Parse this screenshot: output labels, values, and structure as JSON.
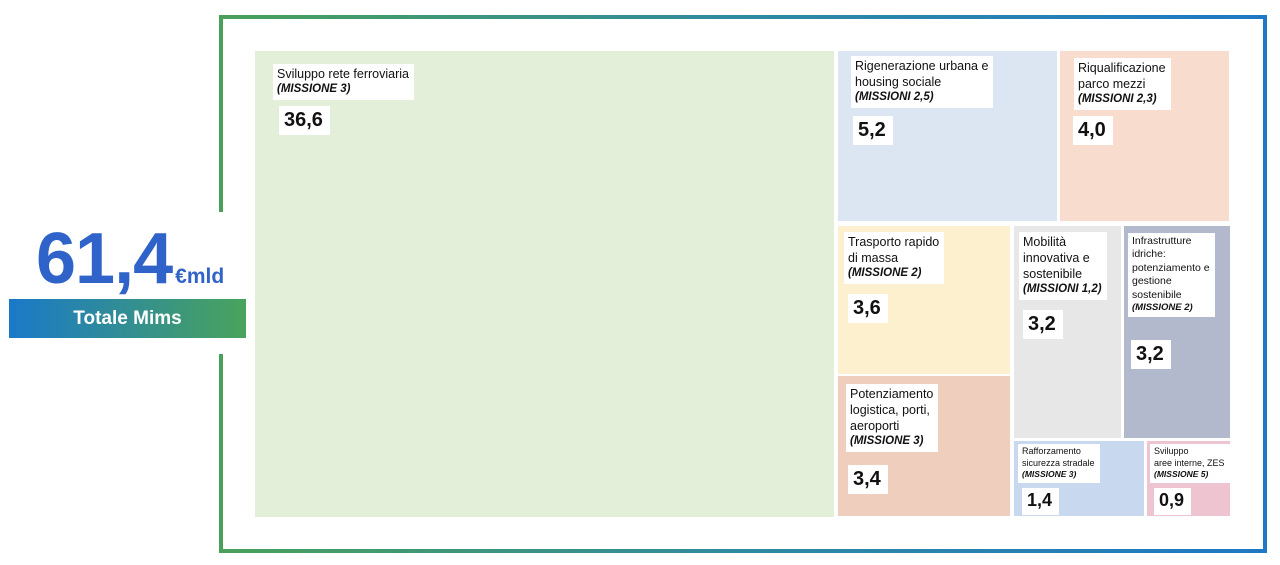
{
  "total": {
    "value": "61,4",
    "unit": "€mld",
    "label": "Totale Mims"
  },
  "chart_data": {
    "type": "treemap",
    "items": [
      {
        "id": "ferrovie",
        "lines": [
          "Sviluppo rete ferroviaria"
        ],
        "missione": "(MISSIONE 3)",
        "value": 36.6,
        "value_label": "36,6",
        "color": "#e3efd9"
      },
      {
        "id": "rigenerazione",
        "lines": [
          "Rigenerazione urbana e",
          "housing sociale"
        ],
        "missione": "(MISSIONI 2,5)",
        "value": 5.2,
        "value_label": "5,2",
        "color": "#dce6f3"
      },
      {
        "id": "parco-mezzi",
        "lines": [
          "Riqualificazione",
          "parco mezzi"
        ],
        "missione": "(MISSIONI 2,3)",
        "value": 4.0,
        "value_label": "4,0",
        "color": "#f8ddcf"
      },
      {
        "id": "trasporto-rapido",
        "lines": [
          "Trasporto rapido",
          "di massa"
        ],
        "missione": "(MISSIONE 2)",
        "value": 3.6,
        "value_label": "3,6",
        "color": "#fdf0cf"
      },
      {
        "id": "logistica",
        "lines": [
          "Potenziamento",
          "logistica, porti,",
          "aeroporti"
        ],
        "missione": "(MISSIONE 3)",
        "value": 3.4,
        "value_label": "3,4",
        "color": "#efcebe"
      },
      {
        "id": "mobilita",
        "lines": [
          "Mobilità",
          "innovativa e",
          "sostenibile"
        ],
        "missione": "(MISSIONI 1,2)",
        "value": 3.2,
        "value_label": "3,2",
        "color": "#e7e7e7"
      },
      {
        "id": "idriche",
        "lines": [
          "Infrastrutture",
          "idriche:",
          "potenziamento e",
          "gestione",
          "sostenibile"
        ],
        "missione": "(MISSIONE 2)",
        "value": 3.2,
        "value_label": "3,2",
        "color": "#b3b9cc"
      },
      {
        "id": "sicurezza",
        "lines": [
          "Rafforzamento",
          "sicurezza stradale"
        ],
        "missione": "(MISSIONE 3)",
        "value": 1.4,
        "value_label": "1,4",
        "color": "#c8d8ee"
      },
      {
        "id": "zes",
        "lines": [
          "Sviluppo",
          "aree interne, ZES"
        ],
        "missione": "(MISSIONE 5)",
        "value": 0.9,
        "value_label": "0,9",
        "color": "#edc4cf"
      }
    ]
  }
}
